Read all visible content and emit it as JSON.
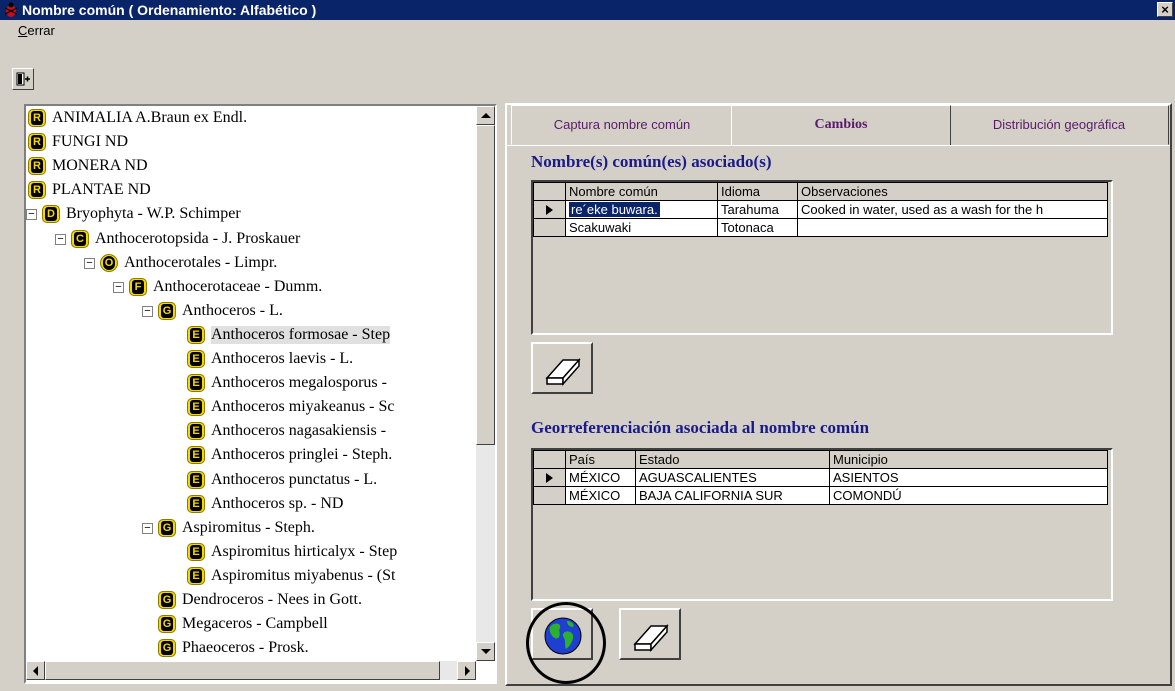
{
  "window": {
    "title": "Nombre común ( Ordenamiento: Alfabético )",
    "close_glyph": "×"
  },
  "menu": {
    "cerrar": "Cerrar"
  },
  "tree": {
    "items": [
      {
        "label": "ANIMALIA A.Braun ex Endl.",
        "rank": "R"
      },
      {
        "label": "FUNGI ND",
        "rank": "R"
      },
      {
        "label": "MONERA ND",
        "rank": "R"
      },
      {
        "label": "PLANTAE ND",
        "rank": "R"
      },
      {
        "label": "Bryophyta - W.P. Schimper",
        "rank": "D",
        "expander": "⊟"
      },
      {
        "label": "Anthocerotopsida - J. Proskauer",
        "rank": "C",
        "expander": "⊟"
      },
      {
        "label": "Anthocerotales - Limpr.",
        "rank": "O",
        "expander": "⊟"
      },
      {
        "label": "Anthocerotaceae - Dumm.",
        "rank": "F",
        "expander": "⊟"
      },
      {
        "label": "Anthoceros - L.",
        "rank": "G",
        "expander": "⊟"
      },
      {
        "label": "Anthoceros formosae - Step",
        "rank": "E",
        "selected": true
      },
      {
        "label": "Anthoceros laevis - L.",
        "rank": "E"
      },
      {
        "label": "Anthoceros megalosporus -",
        "rank": "E"
      },
      {
        "label": "Anthoceros miyakeanus - Sc",
        "rank": "E"
      },
      {
        "label": "Anthoceros nagasakiensis -",
        "rank": "E"
      },
      {
        "label": "Anthoceros pringlei - Steph.",
        "rank": "E"
      },
      {
        "label": "Anthoceros punctatus - L.",
        "rank": "E"
      },
      {
        "label": "Anthoceros sp. - ND",
        "rank": "E"
      },
      {
        "label": "Aspiromitus - Steph.",
        "rank": "G",
        "expander": "⊟"
      },
      {
        "label": "Aspiromitus hirticalyx - Step",
        "rank": "E"
      },
      {
        "label": "Aspiromitus miyabenus - (St",
        "rank": "E"
      },
      {
        "label": "Dendroceros - Nees in Gott.",
        "rank": "G"
      },
      {
        "label": "Megaceros - Campbell",
        "rank": "G"
      },
      {
        "label": "Phaeoceros - Prosk.",
        "rank": "G"
      }
    ]
  },
  "tabs": {
    "captura": "Captura nombre común",
    "cambios": "Cambios",
    "distribucion": "Distribución geográfica"
  },
  "nombres": {
    "title": "Nombre(s) común(es) asociado(s)",
    "headers": [
      "Nombre común",
      "Idioma",
      "Observaciones"
    ],
    "rows": [
      [
        "re´eke buwara.",
        "Tarahuma",
        "Cooked in water, used as a wash for the h"
      ],
      [
        "Scakuwaki",
        "Totonaca",
        ""
      ]
    ]
  },
  "geo": {
    "title": "Georreferenciación asociada al nombre común",
    "headers": [
      "País",
      "Estado",
      "Municipio"
    ],
    "rows": [
      [
        "MÉXICO",
        "AGUASCALIENTES",
        "ASIENTOS"
      ],
      [
        "MÉXICO",
        "BAJA CALIFORNIA SUR",
        "COMONDÚ"
      ]
    ]
  },
  "icons": {
    "app": "bug-icon",
    "exit": "exit-door-icon",
    "eraser": "eraser-icon",
    "globe": "globe-icon"
  },
  "colors": {
    "titlebar": "#0a246a",
    "rank_badge": "#f5d800",
    "section_title": "#1a1a8a",
    "tab_text": "#5a1a6a"
  }
}
